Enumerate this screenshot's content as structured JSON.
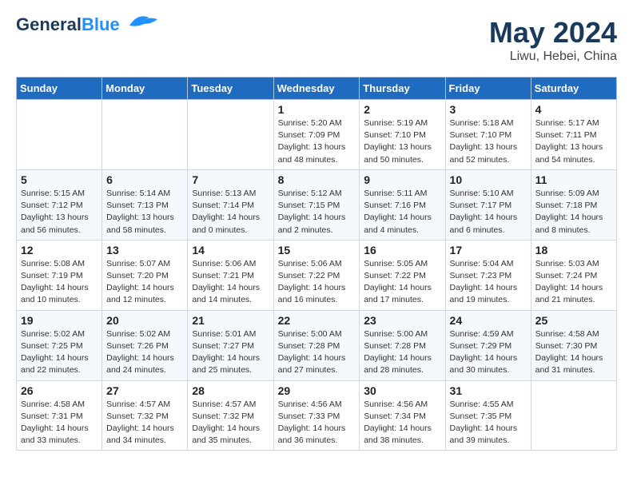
{
  "header": {
    "logo_line1": "General",
    "logo_line2": "Blue",
    "title": "May 2024",
    "subtitle": "Liwu, Hebei, China"
  },
  "days_of_week": [
    "Sunday",
    "Monday",
    "Tuesday",
    "Wednesday",
    "Thursday",
    "Friday",
    "Saturday"
  ],
  "weeks": [
    [
      {
        "day": "",
        "info": ""
      },
      {
        "day": "",
        "info": ""
      },
      {
        "day": "",
        "info": ""
      },
      {
        "day": "1",
        "info": "Sunrise: 5:20 AM\nSunset: 7:09 PM\nDaylight: 13 hours\nand 48 minutes."
      },
      {
        "day": "2",
        "info": "Sunrise: 5:19 AM\nSunset: 7:10 PM\nDaylight: 13 hours\nand 50 minutes."
      },
      {
        "day": "3",
        "info": "Sunrise: 5:18 AM\nSunset: 7:10 PM\nDaylight: 13 hours\nand 52 minutes."
      },
      {
        "day": "4",
        "info": "Sunrise: 5:17 AM\nSunset: 7:11 PM\nDaylight: 13 hours\nand 54 minutes."
      }
    ],
    [
      {
        "day": "5",
        "info": "Sunrise: 5:15 AM\nSunset: 7:12 PM\nDaylight: 13 hours\nand 56 minutes."
      },
      {
        "day": "6",
        "info": "Sunrise: 5:14 AM\nSunset: 7:13 PM\nDaylight: 13 hours\nand 58 minutes."
      },
      {
        "day": "7",
        "info": "Sunrise: 5:13 AM\nSunset: 7:14 PM\nDaylight: 14 hours\nand 0 minutes."
      },
      {
        "day": "8",
        "info": "Sunrise: 5:12 AM\nSunset: 7:15 PM\nDaylight: 14 hours\nand 2 minutes."
      },
      {
        "day": "9",
        "info": "Sunrise: 5:11 AM\nSunset: 7:16 PM\nDaylight: 14 hours\nand 4 minutes."
      },
      {
        "day": "10",
        "info": "Sunrise: 5:10 AM\nSunset: 7:17 PM\nDaylight: 14 hours\nand 6 minutes."
      },
      {
        "day": "11",
        "info": "Sunrise: 5:09 AM\nSunset: 7:18 PM\nDaylight: 14 hours\nand 8 minutes."
      }
    ],
    [
      {
        "day": "12",
        "info": "Sunrise: 5:08 AM\nSunset: 7:19 PM\nDaylight: 14 hours\nand 10 minutes."
      },
      {
        "day": "13",
        "info": "Sunrise: 5:07 AM\nSunset: 7:20 PM\nDaylight: 14 hours\nand 12 minutes."
      },
      {
        "day": "14",
        "info": "Sunrise: 5:06 AM\nSunset: 7:21 PM\nDaylight: 14 hours\nand 14 minutes."
      },
      {
        "day": "15",
        "info": "Sunrise: 5:06 AM\nSunset: 7:22 PM\nDaylight: 14 hours\nand 16 minutes."
      },
      {
        "day": "16",
        "info": "Sunrise: 5:05 AM\nSunset: 7:22 PM\nDaylight: 14 hours\nand 17 minutes."
      },
      {
        "day": "17",
        "info": "Sunrise: 5:04 AM\nSunset: 7:23 PM\nDaylight: 14 hours\nand 19 minutes."
      },
      {
        "day": "18",
        "info": "Sunrise: 5:03 AM\nSunset: 7:24 PM\nDaylight: 14 hours\nand 21 minutes."
      }
    ],
    [
      {
        "day": "19",
        "info": "Sunrise: 5:02 AM\nSunset: 7:25 PM\nDaylight: 14 hours\nand 22 minutes."
      },
      {
        "day": "20",
        "info": "Sunrise: 5:02 AM\nSunset: 7:26 PM\nDaylight: 14 hours\nand 24 minutes."
      },
      {
        "day": "21",
        "info": "Sunrise: 5:01 AM\nSunset: 7:27 PM\nDaylight: 14 hours\nand 25 minutes."
      },
      {
        "day": "22",
        "info": "Sunrise: 5:00 AM\nSunset: 7:28 PM\nDaylight: 14 hours\nand 27 minutes."
      },
      {
        "day": "23",
        "info": "Sunrise: 5:00 AM\nSunset: 7:28 PM\nDaylight: 14 hours\nand 28 minutes."
      },
      {
        "day": "24",
        "info": "Sunrise: 4:59 AM\nSunset: 7:29 PM\nDaylight: 14 hours\nand 30 minutes."
      },
      {
        "day": "25",
        "info": "Sunrise: 4:58 AM\nSunset: 7:30 PM\nDaylight: 14 hours\nand 31 minutes."
      }
    ],
    [
      {
        "day": "26",
        "info": "Sunrise: 4:58 AM\nSunset: 7:31 PM\nDaylight: 14 hours\nand 33 minutes."
      },
      {
        "day": "27",
        "info": "Sunrise: 4:57 AM\nSunset: 7:32 PM\nDaylight: 14 hours\nand 34 minutes."
      },
      {
        "day": "28",
        "info": "Sunrise: 4:57 AM\nSunset: 7:32 PM\nDaylight: 14 hours\nand 35 minutes."
      },
      {
        "day": "29",
        "info": "Sunrise: 4:56 AM\nSunset: 7:33 PM\nDaylight: 14 hours\nand 36 minutes."
      },
      {
        "day": "30",
        "info": "Sunrise: 4:56 AM\nSunset: 7:34 PM\nDaylight: 14 hours\nand 38 minutes."
      },
      {
        "day": "31",
        "info": "Sunrise: 4:55 AM\nSunset: 7:35 PM\nDaylight: 14 hours\nand 39 minutes."
      },
      {
        "day": "",
        "info": ""
      }
    ]
  ]
}
